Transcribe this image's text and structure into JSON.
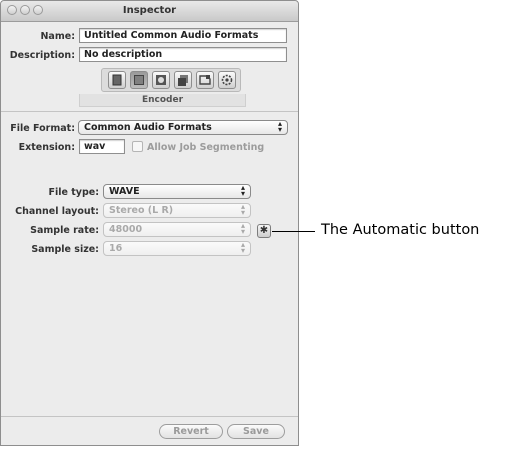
{
  "window": {
    "title": "Inspector"
  },
  "header": {
    "name_label": "Name:",
    "name_value": "Untitled Common Audio Formats",
    "description_label": "Description:",
    "description_value": "No description"
  },
  "toolbar": {
    "buttons": [
      "summary-icon",
      "encoder-icon",
      "frame-controls-icon",
      "geometry-icon",
      "filters-icon",
      "actions-icon"
    ],
    "selected_index": 1,
    "active_tab": "Encoder"
  },
  "format": {
    "file_format_label": "File Format:",
    "file_format_value": "Common Audio Formats",
    "extension_label": "Extension:",
    "extension_value": "wav",
    "allow_segmenting_label": "Allow Job Segmenting"
  },
  "audio": {
    "file_type_label": "File type:",
    "file_type_value": "WAVE",
    "channel_layout_label": "Channel layout:",
    "channel_layout_value": "Stereo (L R)",
    "sample_rate_label": "Sample rate:",
    "sample_rate_value": "48000",
    "sample_size_label": "Sample size:",
    "sample_size_value": "16"
  },
  "footer": {
    "revert_label": "Revert",
    "save_label": "Save"
  },
  "callout": {
    "text": "The Automatic button"
  }
}
